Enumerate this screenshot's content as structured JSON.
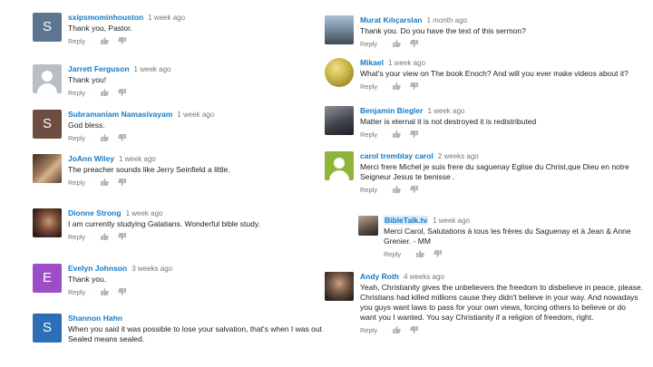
{
  "left_comments": [
    {
      "author": "sxipsmominhouston",
      "time": "1 week ago",
      "text": "Thank you, Pastor.",
      "reply": "Reply",
      "avatar": {
        "letter": "S",
        "color": "#5c7590",
        "type": "letter"
      }
    },
    {
      "author": "Jarrett Ferguson",
      "time": "1 week ago",
      "text": "Thank you!",
      "reply": "Reply",
      "avatar": {
        "letter": "",
        "color": "#b8bfc6",
        "type": "default-user"
      }
    },
    {
      "author": "Subramaniam Namasivayam",
      "time": "1 week ago",
      "text": "God bless.",
      "reply": "Reply",
      "avatar": {
        "letter": "S",
        "color": "#6d4c41",
        "type": "letter"
      }
    },
    {
      "author": "JoAnn Wiley",
      "time": "1 week ago",
      "text": "The preacher sounds like Jerry Seinfield a little.",
      "reply": "Reply",
      "avatar": {
        "letter": "",
        "color": "#8a6a55",
        "type": "photo"
      }
    },
    {
      "author": "Dionne Strong",
      "time": "1 week ago",
      "text": "I am currently studying Galatians. Wonderful bible study.",
      "reply": "Reply",
      "avatar": {
        "letter": "",
        "color": "#7b5a4a",
        "type": "photo"
      }
    },
    {
      "author": "Evelyn Johnson",
      "time": "3 weeks ago",
      "text": "Thank you.",
      "reply": "Reply",
      "avatar": {
        "letter": "E",
        "color": "#9c4dc7",
        "type": "letter"
      }
    },
    {
      "author": "Shannon Hahn",
      "time": "",
      "text": "When you said it was possible to lose your salvation, that's when I was out Sealed means sealed.",
      "reply": "",
      "avatar": {
        "letter": "S",
        "color": "#2d6fb6",
        "type": "letter"
      }
    }
  ],
  "right_comments": [
    {
      "author": "Murat Kılıçarslan",
      "time": "1 month ago",
      "text": "Thank you. Do you have the text of this sermon?",
      "reply": "Reply",
      "avatar": {
        "letter": "",
        "color": "#7f93a8",
        "type": "photo"
      }
    },
    {
      "author": "Mikael",
      "time": "1 week ago",
      "text": "What's your view on The book Enoch? And will you ever make videos about it?",
      "reply": "Reply",
      "avatar": {
        "letter": "",
        "color": "#c9b545",
        "type": "gold-round"
      }
    },
    {
      "author": "Benjamin Biegler",
      "time": "1 week ago",
      "text": "Matter is eternal it is not destroyed it is redistributed",
      "reply": "Reply",
      "avatar": {
        "letter": "",
        "color": "#5a5f66",
        "type": "photo"
      }
    },
    {
      "author": "carol tremblay carol",
      "time": "2 weeks ago",
      "text": "Merci frere Michel je suis frere du saguenay Eglise du Christ,que Dieu en notre Seigneur Jesus te benisse .",
      "reply": "Reply",
      "avatar": {
        "letter": "",
        "color": "#8fb43a",
        "type": "default-user"
      }
    },
    {
      "author": "BibleTalk.tv",
      "time": "1 week ago",
      "text": "Merci Carol, Salutations à tous les frères du Saguenay et à Jean & Anne Grenier. - MM",
      "reply": "Reply",
      "avatar": {
        "letter": "",
        "color": "#6b6f75",
        "type": "photo-small"
      }
    },
    {
      "author": "Andy Roth",
      "time": "4 weeks ago",
      "text": "Yeah, Christianity gives the unbelievers the freedom to disbelieve in peace, please. Christians had killed millions cause they didn't believe in your way. And nowadays you guys want laws to pass for your own views, forcing others to believe or do want you I wanted. You say Christianity if a religion of freedom, right.",
      "reply": "Reply",
      "avatar": {
        "letter": "",
        "color": "#5b4a3c",
        "type": "photo"
      }
    }
  ],
  "icons": {
    "like": "thumbs-up-icon",
    "dislike": "thumbs-down-icon",
    "separator": "·"
  },
  "colors": {
    "author": "#167ac6",
    "meta": "#767676"
  }
}
